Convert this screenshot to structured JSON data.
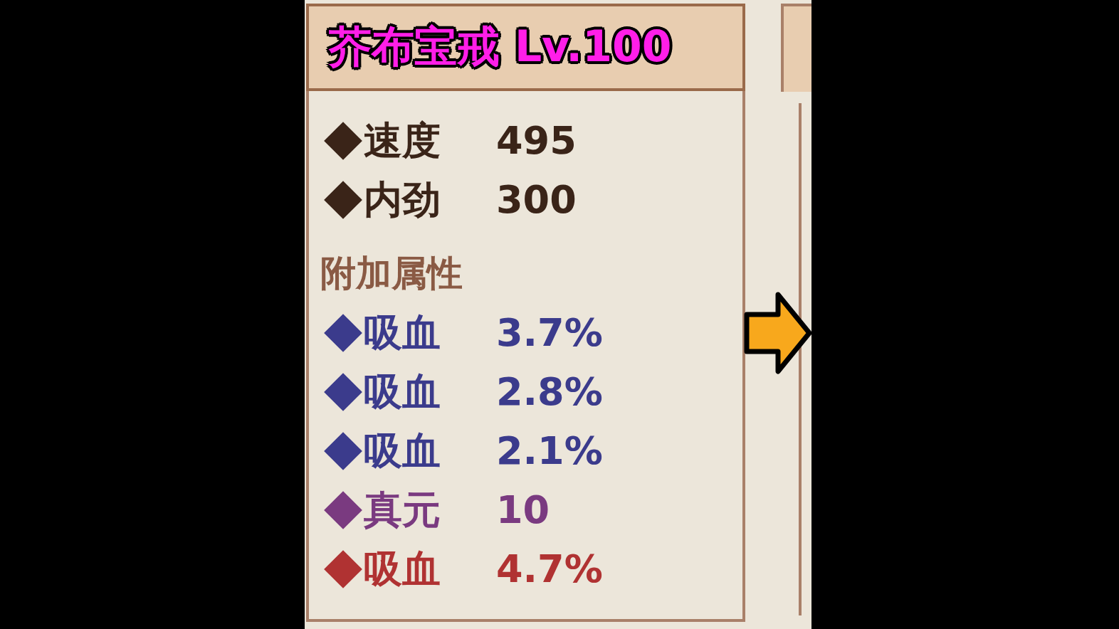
{
  "title": "芥布宝戒 Lv.100",
  "base_stats": [
    {
      "label": "速度",
      "value": "495"
    },
    {
      "label": "内劲",
      "value": "300"
    }
  ],
  "section_title": "附加属性",
  "extra_stats": [
    {
      "label": "吸血",
      "value": "3.7%",
      "color": "#3b3b8c"
    },
    {
      "label": "吸血",
      "value": "2.8%",
      "color": "#3b3b8c"
    },
    {
      "label": "吸血",
      "value": "2.1%",
      "color": "#3b3b8c"
    },
    {
      "label": "真元",
      "value": "10",
      "color": "#7a3a80"
    },
    {
      "label": "吸血",
      "value": "4.7%",
      "color": "#b03232"
    }
  ]
}
